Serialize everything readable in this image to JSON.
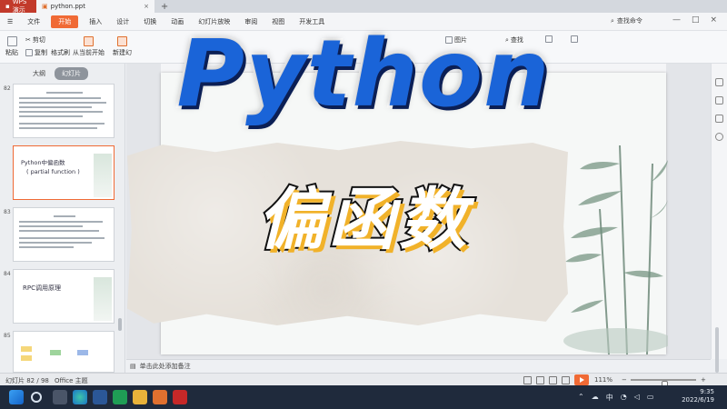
{
  "titlebar": {
    "app_tab": "WPS 演示",
    "file_tab": "python.ppt",
    "new_tab": "+"
  },
  "menubar": {
    "items": [
      "文件",
      "开始",
      "插入",
      "设计",
      "切换",
      "动画",
      "幻灯片放映",
      "审阅",
      "视图",
      "开发工具"
    ],
    "search_label": "查找命令"
  },
  "ribbon": {
    "paste": "粘贴",
    "cut": "剪切",
    "copy": "复制",
    "format_painter": "格式刷",
    "from_current": "从当前开始",
    "new_slide": "新建幻",
    "picture": "图片",
    "find": "查找"
  },
  "left_panel": {
    "tab_outline": "大纲",
    "tab_slides": "幻灯片",
    "slide_numbers": [
      "82",
      "83",
      "84",
      "85"
    ],
    "thumb_title_1a": "Python中偏函数",
    "thumb_title_1b": "( partial function )",
    "thumb_title_3": "RPC调用原理"
  },
  "overlay": {
    "title": "Python",
    "subtitle": "偏函数"
  },
  "notes": {
    "placeholder": "单击此处添加备注"
  },
  "statusbar": {
    "slide_counter": "幻灯片 82 / 98",
    "theme": "Office 主题",
    "zoom": "111%",
    "zoom_level_percent": 111,
    "zoom_minus": "−",
    "zoom_plus": "+"
  },
  "taskbar": {
    "ime": "中",
    "time": "9:35",
    "date": "2022/6/19"
  },
  "colors": {
    "accent": "#f06a35",
    "title_blue": "#1a64d8",
    "subtitle_yellow": "#f1b22a",
    "taskbar": "#1f2a3c"
  }
}
